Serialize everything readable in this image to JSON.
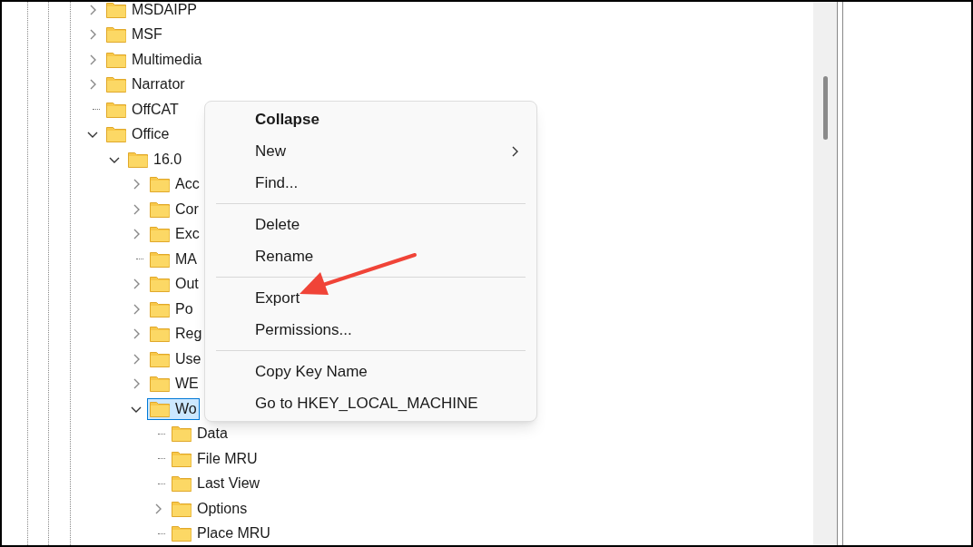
{
  "tree": [
    {
      "label": "MSDAIPP",
      "kind": "branch",
      "expanded": false,
      "selected": false
    },
    {
      "label": "MSF",
      "kind": "branch",
      "expanded": false,
      "selected": false
    },
    {
      "label": "Multimedia",
      "kind": "branch",
      "expanded": false,
      "selected": false
    },
    {
      "label": "Narrator",
      "kind": "branch",
      "expanded": false,
      "selected": false
    },
    {
      "label": "OffCAT",
      "kind": "leaf",
      "selected": false
    },
    {
      "label": "Office",
      "kind": "branch",
      "expanded": true,
      "selected": false,
      "children": [
        {
          "label": "16.0",
          "kind": "branch",
          "expanded": true,
          "selected": false,
          "children": [
            {
              "label": "Acc",
              "kind": "branch",
              "expanded": false,
              "selected": false
            },
            {
              "label": "Cor",
              "kind": "branch",
              "expanded": false,
              "selected": false
            },
            {
              "label": "Exc",
              "kind": "branch",
              "expanded": false,
              "selected": false
            },
            {
              "label": "MA",
              "kind": "leaf",
              "selected": false
            },
            {
              "label": "Out",
              "kind": "branch",
              "expanded": false,
              "selected": false
            },
            {
              "label": "Po",
              "kind": "branch",
              "expanded": false,
              "selected": false
            },
            {
              "label": "Reg",
              "kind": "branch",
              "expanded": false,
              "selected": false
            },
            {
              "label": "Use",
              "kind": "branch",
              "expanded": false,
              "selected": false
            },
            {
              "label": "WE",
              "kind": "branch",
              "expanded": false,
              "selected": false
            },
            {
              "label": "Wo",
              "kind": "branch",
              "expanded": true,
              "selected": true,
              "children": [
                {
                  "label": "Data",
                  "kind": "leaf",
                  "selected": false
                },
                {
                  "label": "File MRU",
                  "kind": "leaf",
                  "selected": false
                },
                {
                  "label": "Last View",
                  "kind": "leaf",
                  "selected": false
                },
                {
                  "label": "Options",
                  "kind": "branch",
                  "expanded": false,
                  "selected": false
                },
                {
                  "label": "Place MRU",
                  "kind": "leaf",
                  "selected": false
                }
              ]
            }
          ]
        }
      ]
    }
  ],
  "context_menu": {
    "sections": [
      [
        {
          "label": "Collapse",
          "default": true,
          "has_submenu": false
        },
        {
          "label": "New",
          "default": false,
          "has_submenu": true
        },
        {
          "label": "Find...",
          "default": false,
          "has_submenu": false
        }
      ],
      [
        {
          "label": "Delete",
          "default": false,
          "has_submenu": false
        },
        {
          "label": "Rename",
          "default": false,
          "has_submenu": false
        }
      ],
      [
        {
          "label": "Export",
          "default": false,
          "has_submenu": false
        },
        {
          "label": "Permissions...",
          "default": false,
          "has_submenu": false
        }
      ],
      [
        {
          "label": "Copy Key Name",
          "default": false,
          "has_submenu": false
        },
        {
          "label": "Go to HKEY_LOCAL_MACHINE",
          "default": false,
          "has_submenu": false
        }
      ]
    ]
  }
}
